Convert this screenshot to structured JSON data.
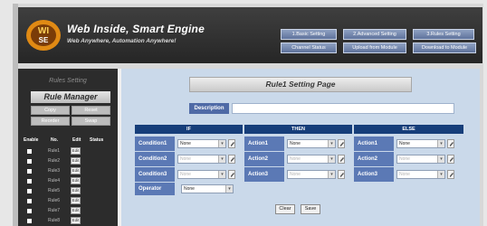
{
  "header": {
    "brand_title": "Web Inside, Smart Engine",
    "brand_subtitle": "Web Anywhere, Automation Anywhere!",
    "nav_row1": [
      "1.Basic Setting",
      "2.Advanced Setting",
      "3.Rules Setting"
    ],
    "nav_row2": [
      "Channel Status",
      "Upload from Module",
      "Download to Module"
    ]
  },
  "sidebar": {
    "heading": "Rules Setting",
    "manager_title": "Rule Manager",
    "buttons": [
      "Copy",
      "Reset",
      "Reorder",
      "Swap"
    ],
    "columns": [
      "Enable",
      "No.",
      "Edit",
      "Status"
    ],
    "edit_label": "Edit",
    "rules": [
      "Rule1",
      "Rule2",
      "Rule3",
      "Rule4",
      "Rule5",
      "Rule6",
      "Rule7",
      "Rule8"
    ]
  },
  "main": {
    "page_title": "Rule1 Setting Page",
    "description_label": "Description",
    "description_value": "",
    "sections": [
      "IF",
      "THEN",
      "ELSE"
    ],
    "conditions": [
      "Condition1",
      "Condition2",
      "Condition3"
    ],
    "actions": [
      "Action1",
      "Action2",
      "Action3"
    ],
    "select_value": "None",
    "operator_label": "Operator",
    "operator_value": "None",
    "clear_label": "Clear",
    "save_label": "Save"
  },
  "colors": {
    "header_bg": "#2e2e2e",
    "main_bg": "#cad9ea",
    "section_head": "#163e7a",
    "row_label": "#5b79b5"
  }
}
